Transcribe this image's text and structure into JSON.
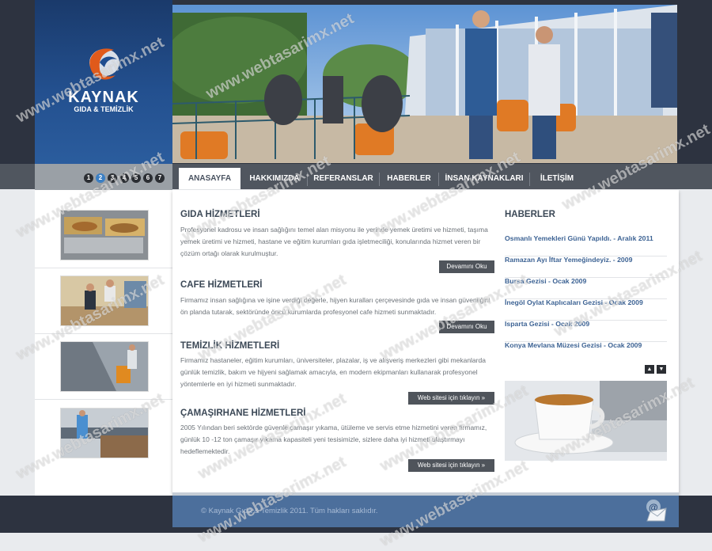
{
  "brand": {
    "name": "KAYNAK",
    "subtitle": "GIDA & TEMİZLİK",
    "accent": "#e05a1b",
    "blue": "#23508f"
  },
  "slider": {
    "numbers": [
      "1",
      "2",
      "3",
      "4",
      "5",
      "6",
      "7"
    ],
    "active": "2"
  },
  "nav": {
    "items": [
      "ANASAYFA",
      "HAKKIMIZDA",
      "REFERANSLAR",
      "HABERLER",
      "İNSAN KAYNAKLARI",
      "İLETİŞİM"
    ],
    "active": "ANASAYFA"
  },
  "sections": [
    {
      "title": "GIDA HİZMETLERİ",
      "text": "Profesyonel kadrosu ve insan sağlığını temel alan misyonu ile yerinde yemek üretimi ve hizmeti, taşıma yemek üretimi ve hizmeti, hastane ve eğitim kurumları gıda işletmeciliği, konularında hizmet veren bir çözüm ortağı olarak kurulmuştur.",
      "button": "Devamını Oku"
    },
    {
      "title": "CAFE HİZMETLERİ",
      "text": "Firmamız insan sağlığına ve işine verdiği değerle, hijyen kuralları çerçevesinde gıda ve insan güvenliğini ön planda tutarak, sektöründe öncü kurumlarda profesyonel cafe hizmeti sunmaktadır.",
      "button": "Devamını Oku"
    },
    {
      "title": "TEMİZLİK HİZMETLERİ",
      "text": "Firmamız hastaneler, eğitim kurumları, üniversiteler, plazalar, iş ve alışveriş merkezleri gibi mekanlarda günlük temizlik, bakım ve hijyeni sağlamak amacıyla, en modern ekipmanları kullanarak profesyonel yöntemlerle en iyi hizmeti sunmaktadır.",
      "button": "Web sitesi için tıklayın »"
    },
    {
      "title": "ÇAMAŞIRHANE HİZMETLERİ",
      "text": "2005 Yılından beri sektörde güvenle çamaşır yıkama, ütüleme ve servis etme hizmetini veren firmamız, günlük 10 -12 ton çamaşır yıkama kapasiteli yeni tesisimizle, sizlere daha iyi hizmeti ulaştırmayı hedeflemektedir.",
      "button": "Web sitesi için tıklayın »"
    }
  ],
  "news": {
    "title": "HABERLER",
    "items": [
      "Osmanlı Yemekleri Günü Yapıldı. - Aralık 2011",
      "Ramazan Ayı İftar Yemeğindeyiz. - 2009",
      "Bursa Gezisi - Ocak 2009",
      "İnegöl Oylat Kaplıcaları Gezisi - Ocak 2009",
      "Isparta Gezisi - Ocak 2009",
      "Konya Mevlana Müzesi Gezisi - Ocak 2009"
    ],
    "up_icon": "arrow-up-icon",
    "down_icon": "arrow-down-icon"
  },
  "footer": {
    "copyright": "© Kaynak Gıda & Temizlik 2011. Tüm hakları saklıdır.",
    "mail_icon": "mail-icon"
  },
  "watermark": "www.webtasarimx.net"
}
